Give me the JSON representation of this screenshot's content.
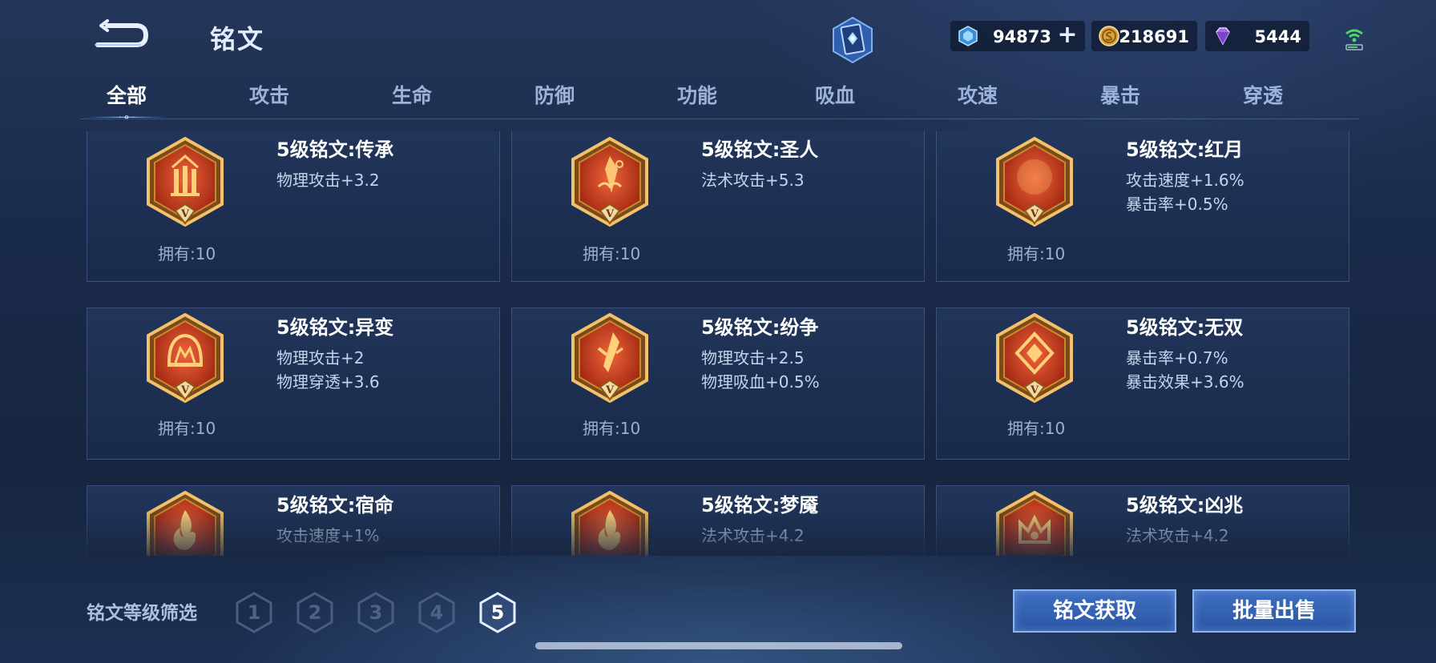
{
  "header": {
    "title": "铭文",
    "currencies": {
      "gem": "94873",
      "coin": "218691",
      "diamond": "5444"
    }
  },
  "tabs": [
    "全部",
    "攻击",
    "生命",
    "防御",
    "功能",
    "吸血",
    "攻速",
    "暴击",
    "穿透"
  ],
  "active_tab": 0,
  "runes": [
    {
      "name": "5级铭文:传承",
      "stats": [
        "物理攻击+3.2"
      ],
      "owned": "拥有:10",
      "emblem": "pillars"
    },
    {
      "name": "5级铭文:圣人",
      "stats": [
        "法术攻击+5.3"
      ],
      "owned": "拥有:10",
      "emblem": "crystal"
    },
    {
      "name": "5级铭文:红月",
      "stats": [
        "攻击速度+1.6%",
        "暴击率+0.5%"
      ],
      "owned": "拥有:10",
      "emblem": "moon"
    },
    {
      "name": "5级铭文:异变",
      "stats": [
        "物理攻击+2",
        "物理穿透+3.6"
      ],
      "owned": "拥有:10",
      "emblem": "helmet"
    },
    {
      "name": "5级铭文:纷争",
      "stats": [
        "物理攻击+2.5",
        "物理吸血+0.5%"
      ],
      "owned": "拥有:10",
      "emblem": "blade"
    },
    {
      "name": "5级铭文:无双",
      "stats": [
        "暴击率+0.7%",
        "暴击效果+3.6%"
      ],
      "owned": "拥有:10",
      "emblem": "diamond"
    },
    {
      "name": "5级铭文:宿命",
      "stats": [
        "攻击速度+1%"
      ],
      "owned": "",
      "emblem": "flame"
    },
    {
      "name": "5级铭文:梦魇",
      "stats": [
        "法术攻击+4.2"
      ],
      "owned": "",
      "emblem": "flame"
    },
    {
      "name": "5级铭文:凶兆",
      "stats": [
        "法术攻击+4.2"
      ],
      "owned": "",
      "emblem": "crown"
    }
  ],
  "badge_numeral": "V",
  "filter": {
    "label": "铭文等级筛选",
    "levels": [
      "1",
      "2",
      "3",
      "4",
      "5"
    ],
    "selected": 4
  },
  "actions": {
    "get_label": "铭文获取",
    "sell_label": "批量出售"
  },
  "colors": {
    "accent_blue": "#3f6fc2",
    "badge_red": "#c9341d",
    "badge_gold": "#e0a64a"
  }
}
